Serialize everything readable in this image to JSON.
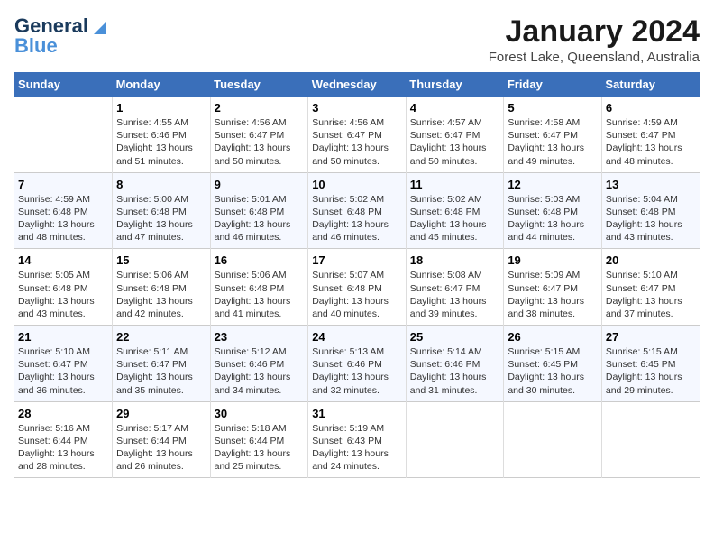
{
  "header": {
    "logo_line1": "General",
    "logo_line2": "Blue",
    "title": "January 2024",
    "subtitle": "Forest Lake, Queensland, Australia"
  },
  "days_of_week": [
    "Sunday",
    "Monday",
    "Tuesday",
    "Wednesday",
    "Thursday",
    "Friday",
    "Saturday"
  ],
  "weeks": [
    [
      {
        "day": "",
        "info": ""
      },
      {
        "day": "1",
        "info": "Sunrise: 4:55 AM\nSunset: 6:46 PM\nDaylight: 13 hours\nand 51 minutes."
      },
      {
        "day": "2",
        "info": "Sunrise: 4:56 AM\nSunset: 6:47 PM\nDaylight: 13 hours\nand 50 minutes."
      },
      {
        "day": "3",
        "info": "Sunrise: 4:56 AM\nSunset: 6:47 PM\nDaylight: 13 hours\nand 50 minutes."
      },
      {
        "day": "4",
        "info": "Sunrise: 4:57 AM\nSunset: 6:47 PM\nDaylight: 13 hours\nand 50 minutes."
      },
      {
        "day": "5",
        "info": "Sunrise: 4:58 AM\nSunset: 6:47 PM\nDaylight: 13 hours\nand 49 minutes."
      },
      {
        "day": "6",
        "info": "Sunrise: 4:59 AM\nSunset: 6:47 PM\nDaylight: 13 hours\nand 48 minutes."
      }
    ],
    [
      {
        "day": "7",
        "info": "Sunrise: 4:59 AM\nSunset: 6:48 PM\nDaylight: 13 hours\nand 48 minutes."
      },
      {
        "day": "8",
        "info": "Sunrise: 5:00 AM\nSunset: 6:48 PM\nDaylight: 13 hours\nand 47 minutes."
      },
      {
        "day": "9",
        "info": "Sunrise: 5:01 AM\nSunset: 6:48 PM\nDaylight: 13 hours\nand 46 minutes."
      },
      {
        "day": "10",
        "info": "Sunrise: 5:02 AM\nSunset: 6:48 PM\nDaylight: 13 hours\nand 46 minutes."
      },
      {
        "day": "11",
        "info": "Sunrise: 5:02 AM\nSunset: 6:48 PM\nDaylight: 13 hours\nand 45 minutes."
      },
      {
        "day": "12",
        "info": "Sunrise: 5:03 AM\nSunset: 6:48 PM\nDaylight: 13 hours\nand 44 minutes."
      },
      {
        "day": "13",
        "info": "Sunrise: 5:04 AM\nSunset: 6:48 PM\nDaylight: 13 hours\nand 43 minutes."
      }
    ],
    [
      {
        "day": "14",
        "info": "Sunrise: 5:05 AM\nSunset: 6:48 PM\nDaylight: 13 hours\nand 43 minutes."
      },
      {
        "day": "15",
        "info": "Sunrise: 5:06 AM\nSunset: 6:48 PM\nDaylight: 13 hours\nand 42 minutes."
      },
      {
        "day": "16",
        "info": "Sunrise: 5:06 AM\nSunset: 6:48 PM\nDaylight: 13 hours\nand 41 minutes."
      },
      {
        "day": "17",
        "info": "Sunrise: 5:07 AM\nSunset: 6:48 PM\nDaylight: 13 hours\nand 40 minutes."
      },
      {
        "day": "18",
        "info": "Sunrise: 5:08 AM\nSunset: 6:47 PM\nDaylight: 13 hours\nand 39 minutes."
      },
      {
        "day": "19",
        "info": "Sunrise: 5:09 AM\nSunset: 6:47 PM\nDaylight: 13 hours\nand 38 minutes."
      },
      {
        "day": "20",
        "info": "Sunrise: 5:10 AM\nSunset: 6:47 PM\nDaylight: 13 hours\nand 37 minutes."
      }
    ],
    [
      {
        "day": "21",
        "info": "Sunrise: 5:10 AM\nSunset: 6:47 PM\nDaylight: 13 hours\nand 36 minutes."
      },
      {
        "day": "22",
        "info": "Sunrise: 5:11 AM\nSunset: 6:47 PM\nDaylight: 13 hours\nand 35 minutes."
      },
      {
        "day": "23",
        "info": "Sunrise: 5:12 AM\nSunset: 6:46 PM\nDaylight: 13 hours\nand 34 minutes."
      },
      {
        "day": "24",
        "info": "Sunrise: 5:13 AM\nSunset: 6:46 PM\nDaylight: 13 hours\nand 32 minutes."
      },
      {
        "day": "25",
        "info": "Sunrise: 5:14 AM\nSunset: 6:46 PM\nDaylight: 13 hours\nand 31 minutes."
      },
      {
        "day": "26",
        "info": "Sunrise: 5:15 AM\nSunset: 6:45 PM\nDaylight: 13 hours\nand 30 minutes."
      },
      {
        "day": "27",
        "info": "Sunrise: 5:15 AM\nSunset: 6:45 PM\nDaylight: 13 hours\nand 29 minutes."
      }
    ],
    [
      {
        "day": "28",
        "info": "Sunrise: 5:16 AM\nSunset: 6:44 PM\nDaylight: 13 hours\nand 28 minutes."
      },
      {
        "day": "29",
        "info": "Sunrise: 5:17 AM\nSunset: 6:44 PM\nDaylight: 13 hours\nand 26 minutes."
      },
      {
        "day": "30",
        "info": "Sunrise: 5:18 AM\nSunset: 6:44 PM\nDaylight: 13 hours\nand 25 minutes."
      },
      {
        "day": "31",
        "info": "Sunrise: 5:19 AM\nSunset: 6:43 PM\nDaylight: 13 hours\nand 24 minutes."
      },
      {
        "day": "",
        "info": ""
      },
      {
        "day": "",
        "info": ""
      },
      {
        "day": "",
        "info": ""
      }
    ]
  ]
}
